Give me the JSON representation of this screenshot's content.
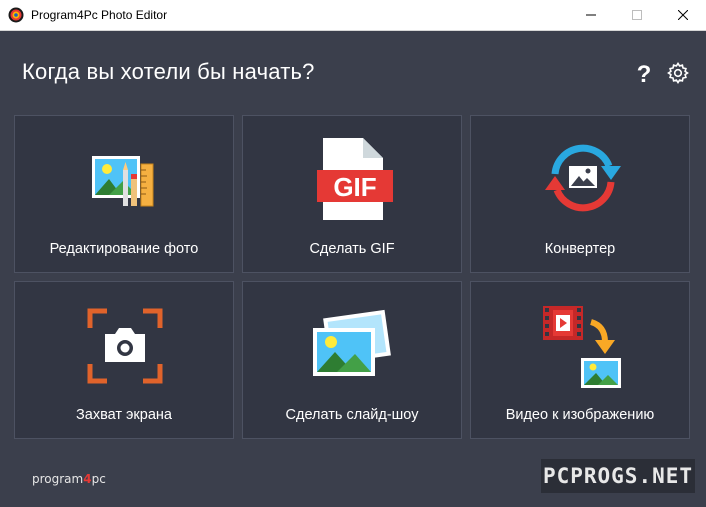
{
  "window": {
    "title": "Program4Pc Photo Editor"
  },
  "main": {
    "heading": "Когда вы хотели бы начать?"
  },
  "tiles": [
    {
      "label": "Редактирование фото",
      "icon": "photo-edit-icon"
    },
    {
      "label": "Сделать GIF",
      "icon": "gif-file-icon",
      "badge": "GIF"
    },
    {
      "label": "Конвертер",
      "icon": "convert-icon"
    },
    {
      "label": "Захват экрана",
      "icon": "screen-capture-icon"
    },
    {
      "label": "Сделать слайд-шоу",
      "icon": "slideshow-icon"
    },
    {
      "label": "Видео к изображению",
      "icon": "video-to-image-icon"
    }
  ],
  "footer": {
    "brand_prefix": "program",
    "brand_number": "4",
    "brand_suffix": "pc",
    "watermark": "PCPROGS.NET"
  },
  "colors": {
    "background": "#3b3f4c",
    "tile": "#323643",
    "accent_red": "#e53935",
    "accent_blue": "#29a8e0",
    "accent_orange": "#e0632b"
  }
}
